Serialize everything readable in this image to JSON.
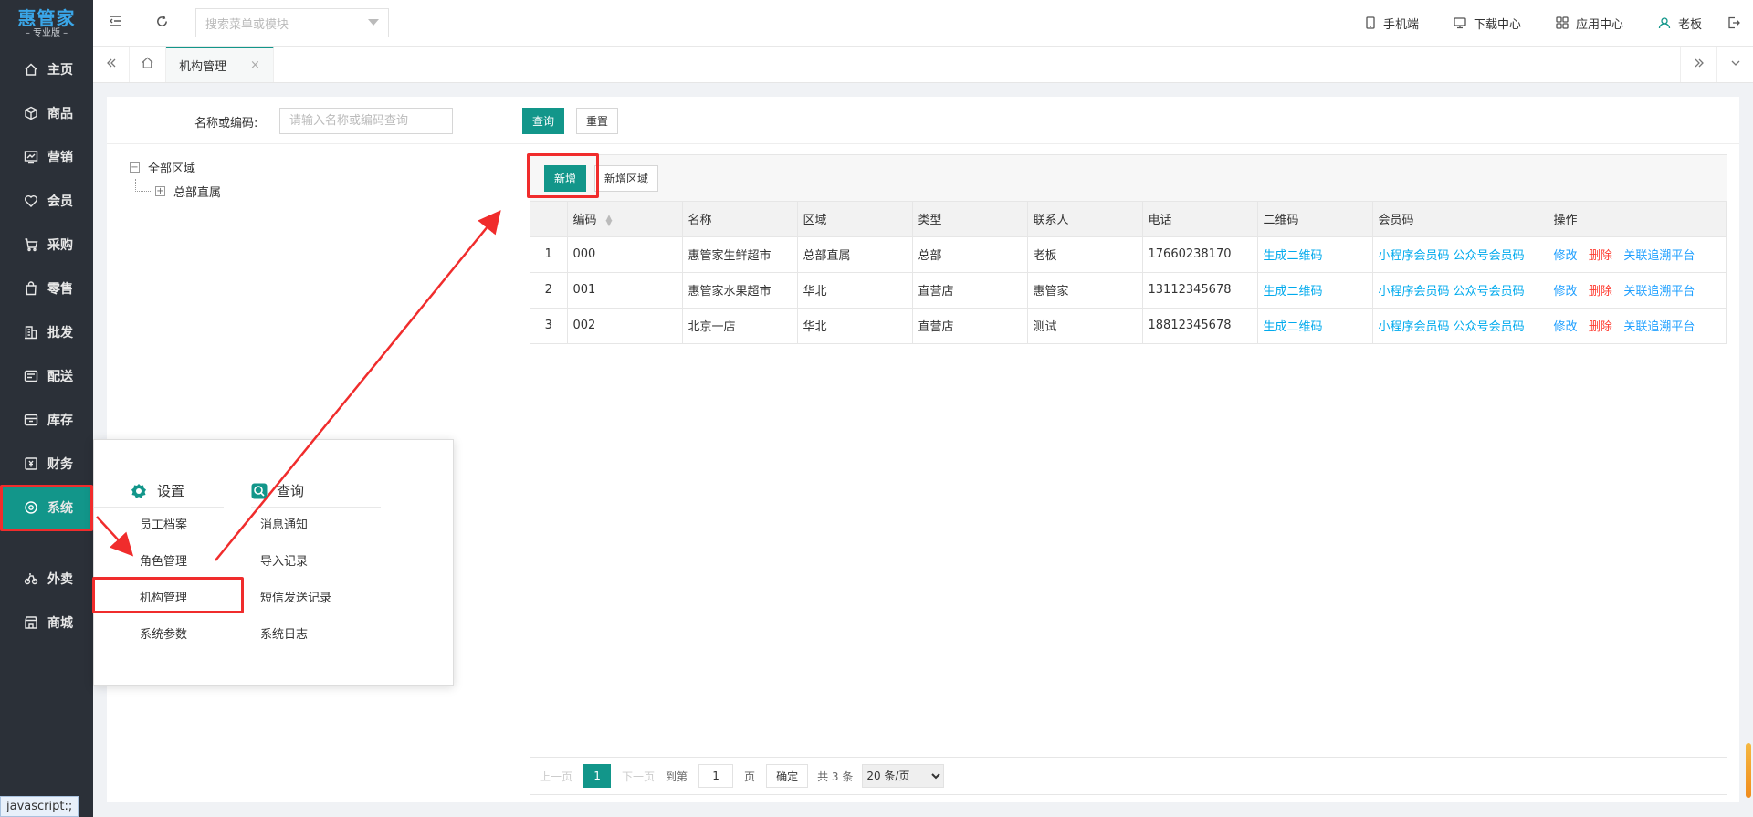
{
  "app": {
    "brand": "惠管家",
    "brand_sub": "– 专业版 –",
    "status_link": "javascript:;"
  },
  "sidebar": {
    "items": [
      {
        "label": "主页",
        "icon": "home-icon"
      },
      {
        "label": "商品",
        "icon": "box-icon"
      },
      {
        "label": "营销",
        "icon": "chart-icon"
      },
      {
        "label": "会员",
        "icon": "heart-icon"
      },
      {
        "label": "采购",
        "icon": "cart-icon"
      },
      {
        "label": "零售",
        "icon": "bag-icon"
      },
      {
        "label": "批发",
        "icon": "building-icon"
      },
      {
        "label": "配送",
        "icon": "truck-icon"
      },
      {
        "label": "库存",
        "icon": "warehouse-icon"
      },
      {
        "label": "财务",
        "icon": "money-icon"
      },
      {
        "label": "系统",
        "icon": "system-icon",
        "active": true
      },
      {
        "label": "外卖",
        "icon": "bike-icon"
      },
      {
        "label": "商城",
        "icon": "shop-icon"
      }
    ]
  },
  "topbar": {
    "search_placeholder": "搜索菜单或模块",
    "links": [
      {
        "label": "手机端",
        "icon": "phone-icon"
      },
      {
        "label": "下载中心",
        "icon": "monitor-icon"
      },
      {
        "label": "应用中心",
        "icon": "apps-icon"
      },
      {
        "label": "老板",
        "icon": "user-icon"
      }
    ]
  },
  "tabs": {
    "active_label": "机构管理"
  },
  "filter": {
    "label": "名称或编码:",
    "placeholder": "请输入名称或编码查询",
    "query_label": "查询",
    "reset_label": "重置"
  },
  "tree": {
    "root": "全部区域",
    "child": "总部直属"
  },
  "grid": {
    "add_label": "新增",
    "add_zone_label": "新增区域",
    "columns": [
      "",
      "编码",
      "名称",
      "区域",
      "类型",
      "联系人",
      "电话",
      "二维码",
      "会员码",
      "操作"
    ],
    "rows": [
      {
        "n": "1",
        "code": "000",
        "name": "惠管家生鲜超市",
        "region": "总部直属",
        "type": "总部",
        "contact": "老板",
        "phone": "17660238170",
        "qr": "生成二维码",
        "mini": "小程序会员码",
        "mp": "公众号会员码",
        "edit": "修改",
        "del": "删除",
        "link": "关联追溯平台"
      },
      {
        "n": "2",
        "code": "001",
        "name": "惠管家水果超市",
        "region": "华北",
        "type": "直营店",
        "contact": "惠管家",
        "phone": "13112345678",
        "qr": "生成二维码",
        "mini": "小程序会员码",
        "mp": "公众号会员码",
        "edit": "修改",
        "del": "删除",
        "link": "关联追溯平台"
      },
      {
        "n": "3",
        "code": "002",
        "name": "北京一店",
        "region": "华北",
        "type": "直营店",
        "contact": "测试",
        "phone": "18812345678",
        "qr": "生成二维码",
        "mini": "小程序会员码",
        "mp": "公众号会员码",
        "edit": "修改",
        "del": "删除",
        "link": "关联追溯平台"
      }
    ]
  },
  "pager": {
    "prev": "上一页",
    "current": "1",
    "next": "下一页",
    "goto": "到第",
    "page_input": "1",
    "page_unit": "页",
    "confirm": "确定",
    "total": "共 3 条",
    "page_size": "20 条/页"
  },
  "popup": {
    "settings_title": "设置",
    "settings_items": [
      "员工档案",
      "角色管理",
      "机构管理",
      "系统参数"
    ],
    "query_title": "查询",
    "query_items": [
      "消息通知",
      "导入记录",
      "短信发送记录",
      "系统日志"
    ]
  },
  "colors": {
    "primary": "#12968a",
    "sidebar_bg": "#2b3038",
    "link": "#1e9fff",
    "danger": "#ff3b30",
    "annotation": "#f02c2c"
  }
}
